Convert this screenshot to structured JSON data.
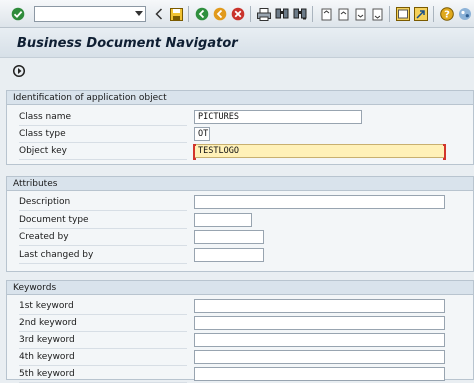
{
  "toolbar": {
    "command_field_value": "",
    "icons": [
      "enter-icon",
      "back-icon",
      "save-icon",
      "back-nav-icon",
      "exit-icon",
      "cancel-icon",
      "print-icon",
      "find-icon",
      "find-next-icon",
      "first-page-icon",
      "prev-page-icon",
      "next-page-icon",
      "last-page-icon",
      "new-session-icon",
      "shortcut-icon",
      "help-icon",
      "layout-menu-icon"
    ]
  },
  "title": "Business Document Navigator",
  "sections": {
    "identification": {
      "header": "Identification of application object",
      "class_name_label": "Class name",
      "class_name_value": "PICTURES",
      "class_type_label": "Class type",
      "class_type_value": "OT",
      "object_key_label": "Object key",
      "object_key_value": "TESTLOGO"
    },
    "attributes": {
      "header": "Attributes",
      "description_label": "Description",
      "description_value": "",
      "document_type_label": "Document type",
      "document_type_value": "",
      "created_by_label": "Created by",
      "created_by_value": "",
      "last_changed_by_label": "Last changed by",
      "last_changed_by_value": ""
    },
    "keywords": {
      "header": "Keywords",
      "kw1_label": "1st keyword",
      "kw2_label": "2nd keyword",
      "kw3_label": "3rd keyword",
      "kw4_label": "4th keyword",
      "kw5_label": "5th keyword",
      "kw1_value": "",
      "kw2_value": "",
      "kw3_value": "",
      "kw4_value": "",
      "kw5_value": ""
    }
  }
}
